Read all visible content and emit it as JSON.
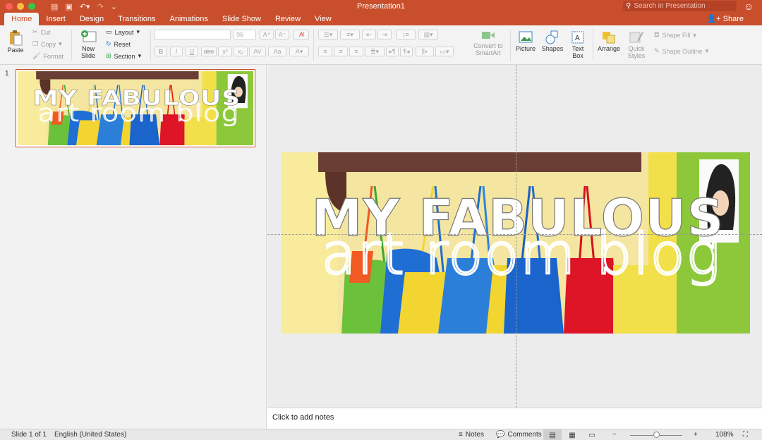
{
  "titlebar": {
    "doc_title": "Presentation1",
    "search_placeholder": "Search in Presentation",
    "lights": [
      "#fc605b",
      "#fdbc40",
      "#34c84a"
    ],
    "accent": "#c94f2c"
  },
  "tabs": [
    {
      "label": "Home",
      "active": true
    },
    {
      "label": "Insert"
    },
    {
      "label": "Design"
    },
    {
      "label": "Transitions"
    },
    {
      "label": "Animations"
    },
    {
      "label": "Slide Show"
    },
    {
      "label": "Review"
    },
    {
      "label": "View"
    }
  ],
  "share_label": "Share",
  "ribbon": {
    "paste": "Paste",
    "cut": "Cut",
    "copy": "Copy",
    "format": "Format",
    "new_slide_1": "New",
    "new_slide_2": "Slide",
    "layout": "Layout",
    "reset": "Reset",
    "section": "Section",
    "font_size": "96",
    "convert_1": "Convert to",
    "convert_2": "SmartArt",
    "picture": "Picture",
    "shapes": "Shapes",
    "textbox_1": "Text",
    "textbox_2": "Box",
    "arrange": "Arrange",
    "quick_1": "Quick",
    "quick_2": "Styles",
    "shape_fill": "Shape Fill",
    "shape_outline": "Shape Outline"
  },
  "slides": [
    {
      "number": "1",
      "title_line1": "MY FABULOUS",
      "title_line2": "art room blog"
    }
  ],
  "notes_placeholder": "Click to add notes",
  "status": {
    "slide_of": "Slide 1 of 1",
    "language": "English (United States)",
    "notes": "Notes",
    "comments": "Comments",
    "zoom": "108%"
  }
}
